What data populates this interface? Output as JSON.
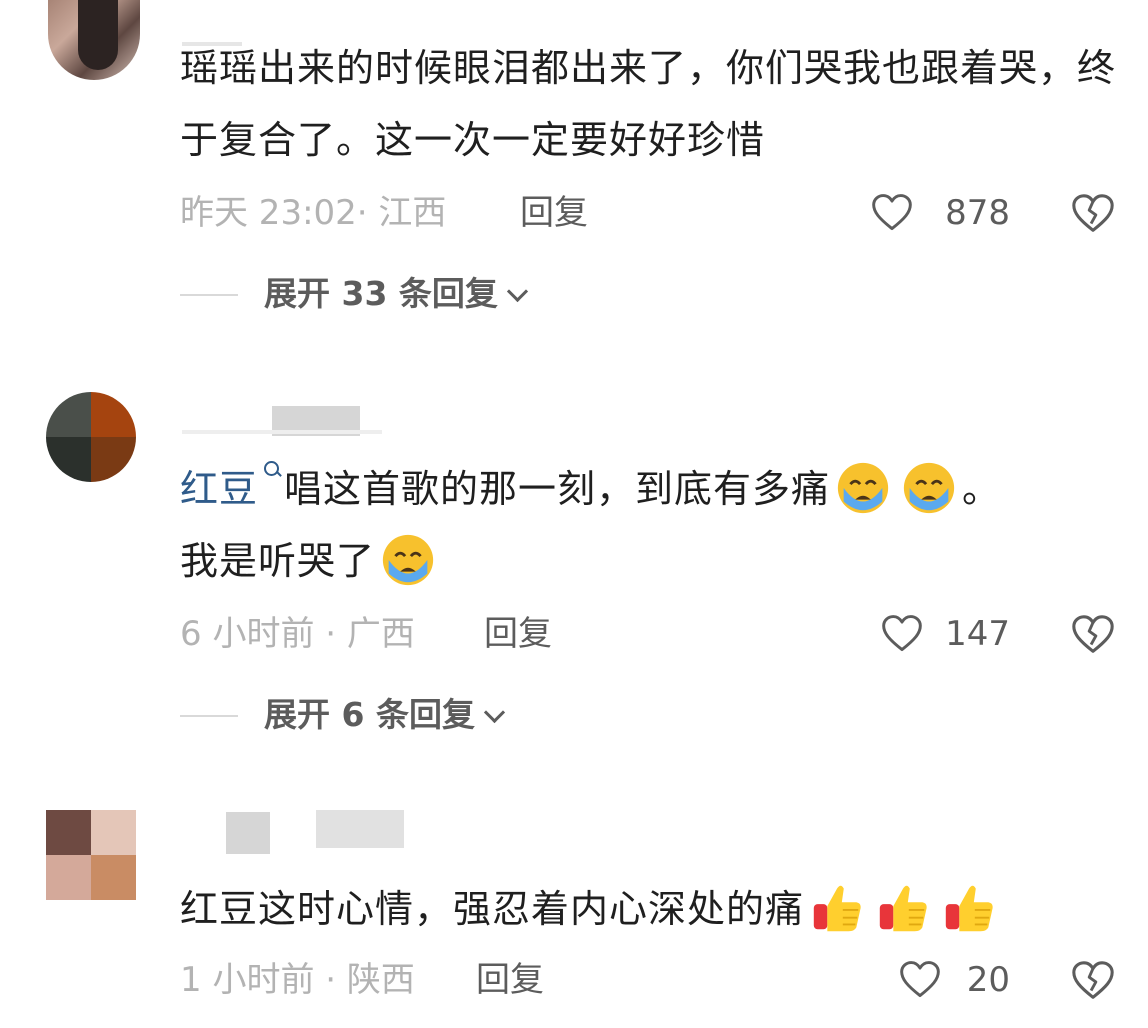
{
  "comments": [
    {
      "text": "瑶瑶出来的时候眼泪都出来了，你们哭我也跟着哭，终于复合了。这一次一定要好好珍惜",
      "time_location": "昨天 23:02· 江西",
      "reply_label": "回复",
      "likes": "878",
      "expand_label": "展开 33 条回复"
    },
    {
      "mention": "红豆",
      "text_part1": "唱这首歌的那一刻，到底有多痛",
      "text_part2": "。",
      "text_part3": "我是听哭了",
      "time_location": "6 小时前 · 广西",
      "reply_label": "回复",
      "likes": "147",
      "expand_label": "展开 6 条回复"
    },
    {
      "text": "红豆这时心情，强忍着内心深处的痛",
      "time_location": "1 小时前 · 陕西",
      "reply_label": "回复",
      "likes": "20"
    }
  ],
  "icons": {
    "like": "heart-outline-icon",
    "dislike": "broken-heart-icon",
    "crying": "loudly-crying-face-emoji",
    "thumbs_up": "thumbs-up-emoji",
    "mention": "search-mention-icon",
    "expand": "chevron-down-icon"
  },
  "colors": {
    "text": "#1f1f1f",
    "meta": "#b3b3b3",
    "action": "#5c5c5c",
    "mention": "#2f5b8a"
  }
}
